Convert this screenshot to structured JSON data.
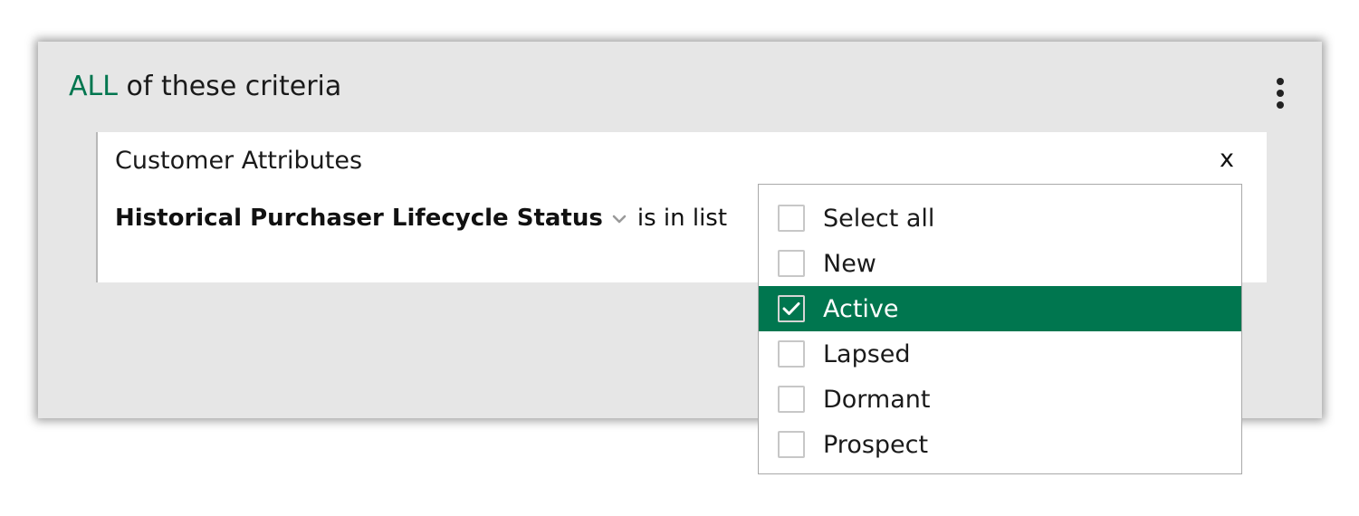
{
  "group": {
    "quantifier": "ALL",
    "title_rest": "of these criteria",
    "menu_icon": "kebab-menu-icon"
  },
  "criterion": {
    "category": "Customer Attributes",
    "close_label": "x",
    "attribute": "Historical Purchaser Lifecycle Status",
    "attribute_icon": "chevron-down-icon",
    "operator": "is in list"
  },
  "dropdown": {
    "options": [
      {
        "label": "Select all",
        "checked": false
      },
      {
        "label": "New",
        "checked": false
      },
      {
        "label": "Active",
        "checked": true
      },
      {
        "label": "Lapsed",
        "checked": false
      },
      {
        "label": "Dormant",
        "checked": false
      },
      {
        "label": "Prospect",
        "checked": false
      }
    ]
  },
  "colors": {
    "accent": "#00764f",
    "panel_bg": "#e6e6e6",
    "card_bg": "#ffffff"
  }
}
